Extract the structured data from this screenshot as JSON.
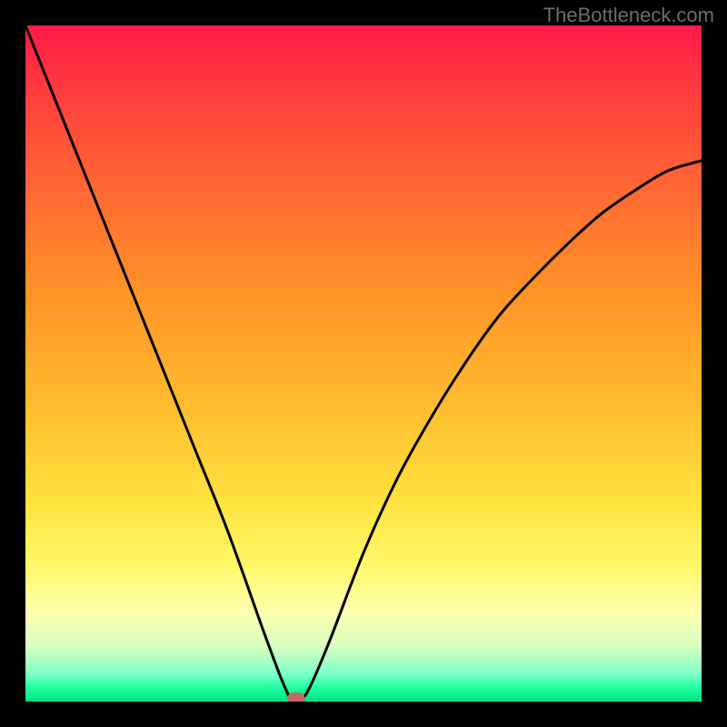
{
  "watermark": {
    "text": "TheBottleneck.com"
  },
  "chart_data": {
    "type": "line",
    "title": "",
    "xlabel": "",
    "ylabel": "",
    "xlim": [
      0,
      1
    ],
    "ylim": [
      0,
      1
    ],
    "grid": false,
    "series": [
      {
        "name": "bottleneck-curve",
        "x": [
          0.0,
          0.05,
          0.1,
          0.15,
          0.2,
          0.25,
          0.3,
          0.35,
          0.38,
          0.395,
          0.405,
          0.42,
          0.45,
          0.5,
          0.55,
          0.6,
          0.65,
          0.7,
          0.75,
          0.8,
          0.85,
          0.9,
          0.95,
          1.0
        ],
        "values": [
          1.0,
          0.875,
          0.75,
          0.625,
          0.5,
          0.375,
          0.25,
          0.11,
          0.03,
          0.0,
          0.0,
          0.02,
          0.09,
          0.22,
          0.33,
          0.42,
          0.5,
          0.57,
          0.625,
          0.675,
          0.72,
          0.755,
          0.785,
          0.8
        ]
      }
    ],
    "annotations": [
      {
        "name": "optimal-point",
        "x": 0.4,
        "y": 0.005,
        "shape": "rounded-rect",
        "color": "#c26a65"
      }
    ],
    "background": {
      "type": "vertical-gradient",
      "stops": [
        {
          "pos": 0.0,
          "color": "#ff1a47"
        },
        {
          "pos": 0.55,
          "color": "#ffb92e"
        },
        {
          "pos": 0.8,
          "color": "#fff86a"
        },
        {
          "pos": 0.96,
          "color": "#7affc8"
        },
        {
          "pos": 1.0,
          "color": "#00e07f"
        }
      ]
    }
  }
}
